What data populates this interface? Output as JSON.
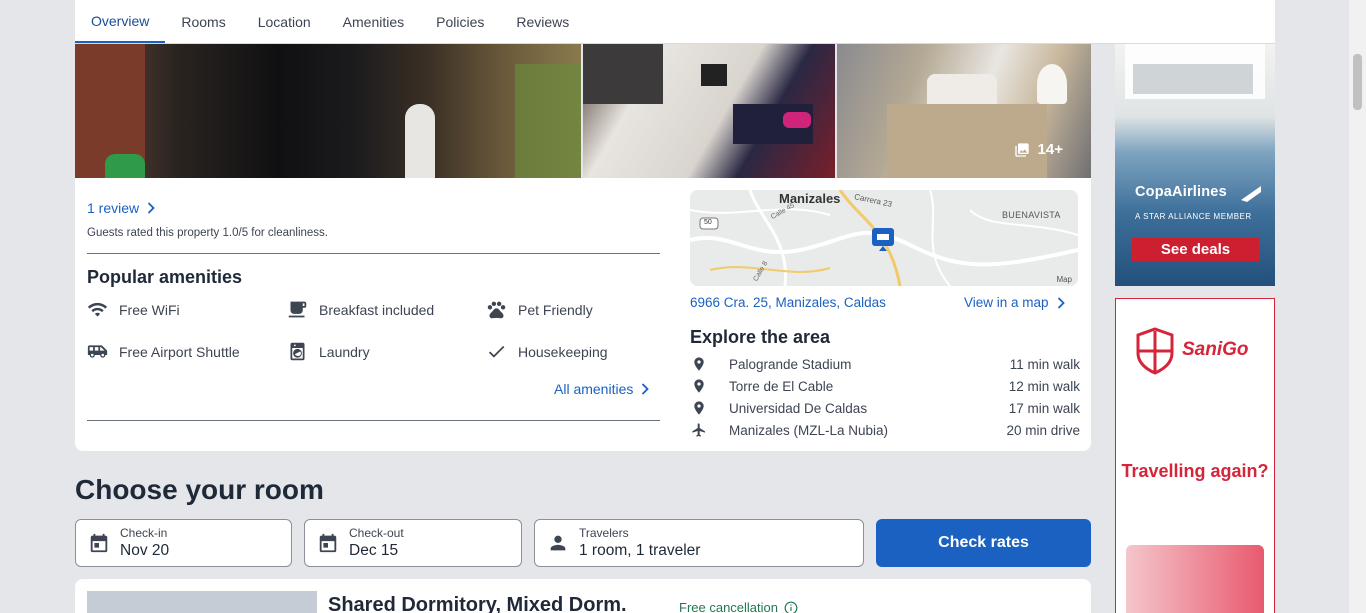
{
  "tabs": [
    {
      "label": "Overview",
      "active": true
    },
    {
      "label": "Rooms"
    },
    {
      "label": "Location"
    },
    {
      "label": "Amenities"
    },
    {
      "label": "Policies"
    },
    {
      "label": "Reviews"
    }
  ],
  "gallery": {
    "more_count": "14+",
    "more_icon": "photo-stack-icon"
  },
  "reviews": {
    "link": "1 review",
    "note": "Guests rated this property 1.0/5 for cleanliness."
  },
  "amenities": {
    "title": "Popular amenities",
    "items": [
      {
        "label": "Free WiFi",
        "icon": "wifi-icon"
      },
      {
        "label": "Breakfast included",
        "icon": "coffee-icon"
      },
      {
        "label": "Pet Friendly",
        "icon": "paw-icon"
      },
      {
        "label": "Free Airport Shuttle",
        "icon": "shuttle-icon"
      },
      {
        "label": "Laundry",
        "icon": "laundry-icon"
      },
      {
        "label": "Housekeeping",
        "icon": "check-icon"
      }
    ],
    "all_link": "All amenities"
  },
  "map": {
    "city_label": "Manizales",
    "street_label": "Carrera 23",
    "area_label": "BUENAVISTA",
    "road_label": "Calle 45",
    "road2_label": "Calle 8",
    "route_badge": "50",
    "attribution": "Map"
  },
  "location": {
    "address": "6966 Cra. 25, Manizales, Caldas",
    "view_map": "View in a map"
  },
  "explore": {
    "title": "Explore the area",
    "items": [
      {
        "name": "Palogrande Stadium",
        "dist": "11 min walk",
        "icon": "location-pin-icon"
      },
      {
        "name": "Torre de El Cable",
        "dist": "12 min walk",
        "icon": "location-pin-icon"
      },
      {
        "name": "Universidad De Caldas",
        "dist": "17 min walk",
        "icon": "location-pin-icon"
      },
      {
        "name": "Manizales (MZL-La Nubia)",
        "dist": "20 min drive",
        "icon": "airplane-icon"
      }
    ]
  },
  "choose": {
    "title": "Choose your room",
    "checkin": {
      "label": "Check-in",
      "value": "Nov 20"
    },
    "checkout": {
      "label": "Check-out",
      "value": "Dec 15"
    },
    "travelers": {
      "label": "Travelers",
      "value": "1 room, 1 traveler"
    },
    "button": "Check rates"
  },
  "room": {
    "title": "Shared Dormitory, Mixed Dorm.",
    "cancellation": "Free cancellation"
  },
  "ads": {
    "copa": {
      "brand": "CopaAirlines",
      "sub": "A STAR ALLIANCE MEMBER",
      "cta": "See deals"
    },
    "sanigo": {
      "brand": "SaniGo",
      "slogan": "Travelling again?"
    }
  },
  "colors": {
    "accent": "#1a61c2",
    "green": "#227950",
    "ad_red": "#d6253a"
  }
}
